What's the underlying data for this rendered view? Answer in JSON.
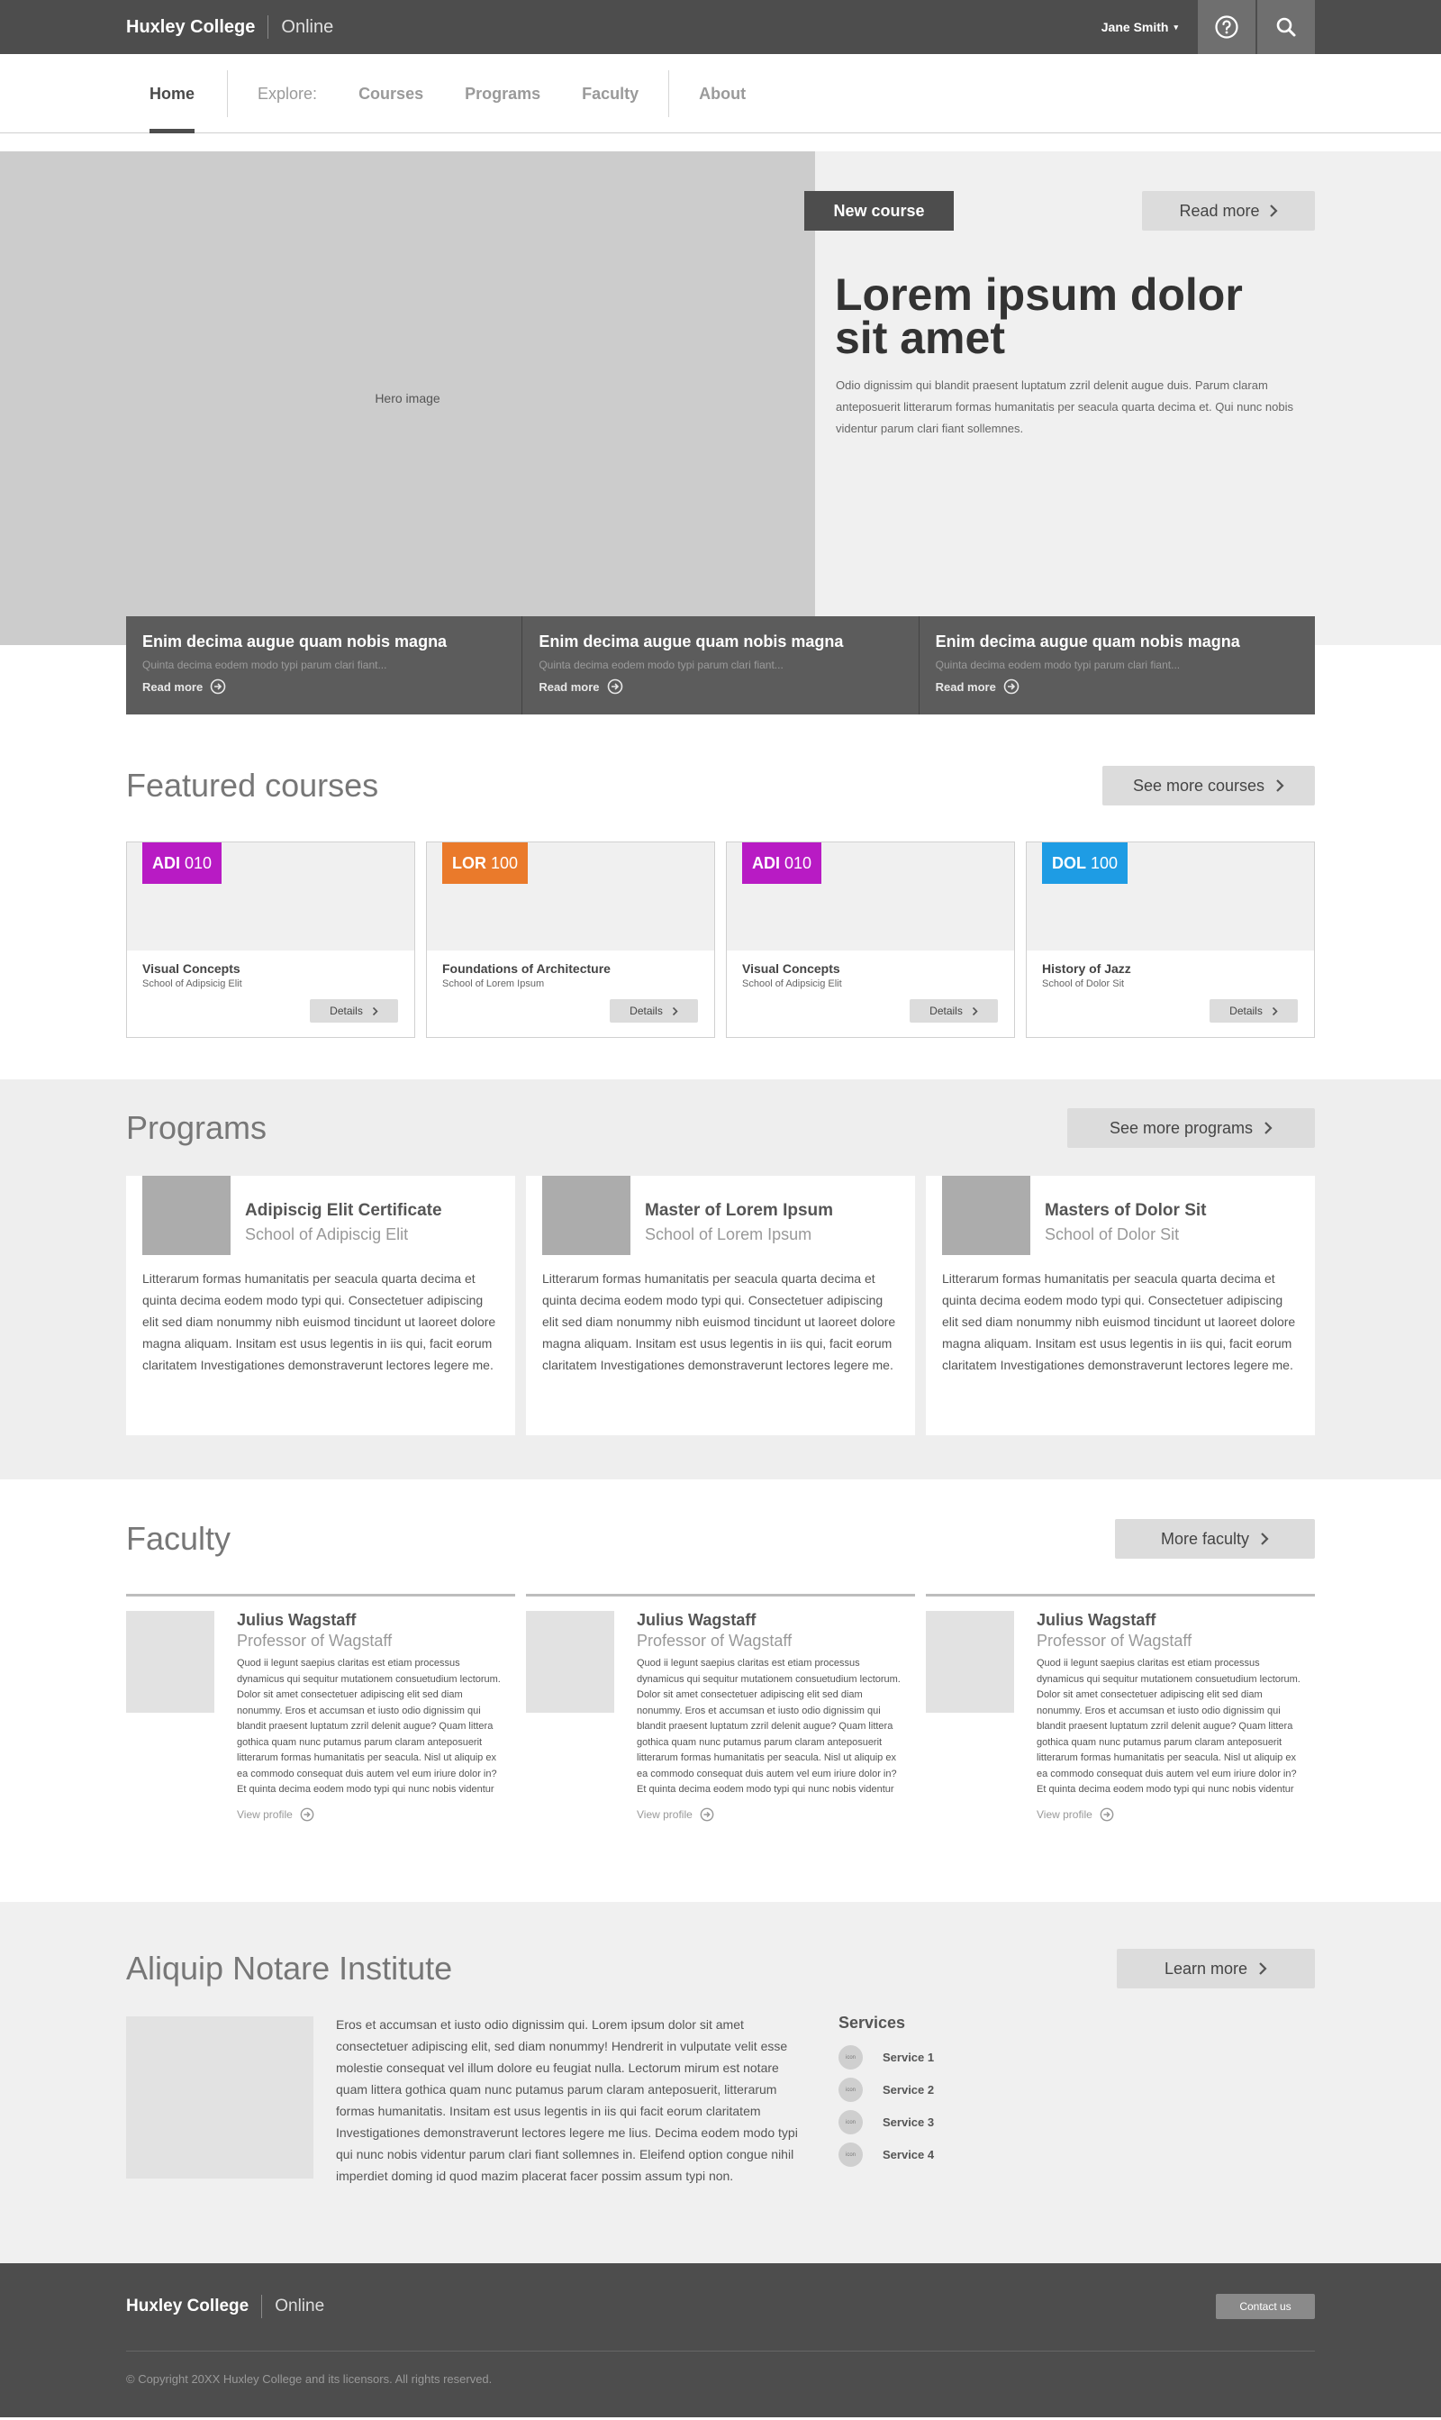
{
  "topbar": {
    "brand": "Huxley College",
    "brand_sub": "Online",
    "user": "Jane Smith",
    "caret": "▾"
  },
  "nav": {
    "home": "Home",
    "explore": "Explore:",
    "courses": "Courses",
    "programs": "Programs",
    "faculty": "Faculty",
    "about": "About"
  },
  "hero": {
    "image_label": "Hero image",
    "badge": "New course",
    "read_more": "Read more",
    "title": "Lorem ipsum dolor sit amet",
    "text": "Odio dignissim qui blandit praesent luptatum zzril delenit augue duis. Parum claram anteposuerit litterarum formas humanitatis per seacula quarta decima et. Qui nunc nobis videntur parum clari fiant sollemnes.",
    "cards": [
      {
        "title": "Enim decima augue quam nobis magna",
        "sub": "Quinta decima eodem modo typi parum clari fiant...",
        "link": "Read more"
      },
      {
        "title": "Enim decima augue quam nobis magna",
        "sub": "Quinta decima eodem modo typi parum clari fiant...",
        "link": "Read more"
      },
      {
        "title": "Enim decima augue quam nobis magna",
        "sub": "Quinta decima eodem modo typi parum clari fiant...",
        "link": "Read more"
      }
    ]
  },
  "featured": {
    "title": "Featured courses",
    "more": "See more courses",
    "details": "Details",
    "courses": [
      {
        "dept": "ADI",
        "num": "010",
        "color": "#b81bc4",
        "name": "Visual Concepts",
        "school": "School of Adipsicig Elit"
      },
      {
        "dept": "LOR",
        "num": "100",
        "color": "#ea7a2b",
        "name": "Foundations of Architecture",
        "school": "School of Lorem Ipsum"
      },
      {
        "dept": "ADI",
        "num": "010",
        "color": "#b81bc4",
        "name": "Visual Concepts",
        "school": "School of Adipsicig Elit"
      },
      {
        "dept": "DOL",
        "num": "100",
        "color": "#1e9ce4",
        "name": "History of Jazz",
        "school": "School of Dolor Sit"
      }
    ]
  },
  "programs": {
    "title": "Programs",
    "more": "See more programs",
    "items": [
      {
        "name": "Adipiscig Elit Certificate",
        "school": "School of Adipiscig Elit",
        "text": "Litterarum formas humanitatis per seacula quarta decima et quinta decima eodem modo typi qui. Consectetuer adipiscing elit sed diam nonummy nibh euismod tincidunt ut laoreet dolore magna aliquam. Insitam est usus legentis in iis qui, facit eorum claritatem Investigationes demonstraverunt lectores legere me."
      },
      {
        "name": "Master of Lorem Ipsum",
        "school": "School of Lorem Ipsum",
        "text": "Litterarum formas humanitatis per seacula quarta decima et quinta decima eodem modo typi qui. Consectetuer adipiscing elit sed diam nonummy nibh euismod tincidunt ut laoreet dolore magna aliquam. Insitam est usus legentis in iis qui, facit eorum claritatem Investigationes demonstraverunt lectores legere me."
      },
      {
        "name": "Masters of Dolor Sit",
        "school": "School of Dolor Sit",
        "text": "Litterarum formas humanitatis per seacula quarta decima et quinta decima eodem modo typi qui. Consectetuer adipiscing elit sed diam nonummy nibh euismod tincidunt ut laoreet dolore magna aliquam. Insitam est usus legentis in iis qui, facit eorum claritatem Investigationes demonstraverunt lectores legere me."
      }
    ]
  },
  "faculty": {
    "title": "Faculty",
    "more": "More faculty",
    "link": "View profile",
    "members": [
      {
        "name": "Julius Wagstaff",
        "title": "Professor of Wagstaff",
        "bio": "Quod ii legunt saepius claritas est etiam processus dynamicus qui sequitur mutationem consuetudium lectorum. Dolor sit amet consectetuer adipiscing elit sed diam nonummy. Eros et accumsan et iusto odio dignissim qui blandit praesent luptatum zzril delenit augue? Quam littera gothica quam nunc putamus parum claram anteposuerit litterarum formas humanitatis per seacula. Nisl ut aliquip ex ea commodo consequat duis autem vel eum iriure dolor in? Et quinta decima eodem modo typi qui nunc nobis videntur"
      },
      {
        "name": "Julius Wagstaff",
        "title": "Professor of Wagstaff",
        "bio": "Quod ii legunt saepius claritas est etiam processus dynamicus qui sequitur mutationem consuetudium lectorum. Dolor sit amet consectetuer adipiscing elit sed diam nonummy. Eros et accumsan et iusto odio dignissim qui blandit praesent luptatum zzril delenit augue? Quam littera gothica quam nunc putamus parum claram anteposuerit litterarum formas humanitatis per seacula. Nisl ut aliquip ex ea commodo consequat duis autem vel eum iriure dolor in? Et quinta decima eodem modo typi qui nunc nobis videntur"
      },
      {
        "name": "Julius Wagstaff",
        "title": "Professor of Wagstaff",
        "bio": "Quod ii legunt saepius claritas est etiam processus dynamicus qui sequitur mutationem consuetudium lectorum. Dolor sit amet consectetuer adipiscing elit sed diam nonummy. Eros et accumsan et iusto odio dignissim qui blandit praesent luptatum zzril delenit augue? Quam littera gothica quam nunc putamus parum claram anteposuerit litterarum formas humanitatis per seacula. Nisl ut aliquip ex ea commodo consequat duis autem vel eum iriure dolor in? Et quinta decima eodem modo typi qui nunc nobis videntur"
      }
    ]
  },
  "institute": {
    "title": "Aliquip Notare Institute",
    "more": "Learn more",
    "text": "Eros et accumsan et iusto odio dignissim qui. Lorem ipsum dolor sit amet consectetuer adipiscing elit, sed diam nonummy! Hendrerit in vulputate velit esse molestie consequat vel illum dolore eu feugiat nulla. Lectorum mirum est notare quam littera gothica quam nunc putamus parum claram anteposuerit, litterarum formas humanitatis. Insitam est usus legentis in iis qui facit eorum claritatem Investigationes demonstraverunt lectores legere me lius. Decima eodem modo typi qui nunc nobis videntur parum clari fiant sollemnes in. Eleifend option congue nihil imperdiet doming id quod mazim placerat facer possim assum typi non.",
    "services_title": "Services",
    "icon_label": "icon",
    "services": [
      "Service 1",
      "Service 2",
      "Service 3",
      "Service 4"
    ]
  },
  "footer": {
    "brand": "Huxley College",
    "brand_sub": "Online",
    "contact": "Contact us",
    "copyright": "© Copyright 20XX Huxley College and its licensors. All rights reserved."
  },
  "icons": {
    "help": "help-circle-icon",
    "search": "search-icon",
    "chevron": "chevron-right-icon",
    "arrow": "arrow-circle-right-icon"
  }
}
